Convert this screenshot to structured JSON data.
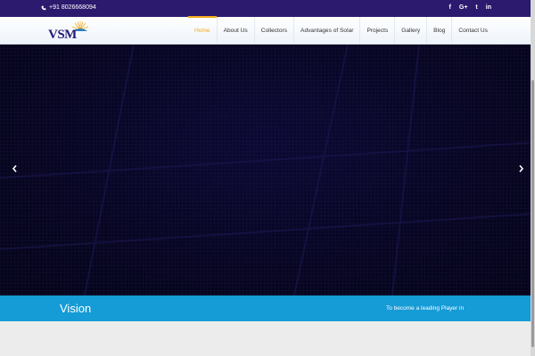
{
  "topbar": {
    "phone": "+91 8026668094",
    "social": [
      {
        "icon": "facebook-icon",
        "glyph": "f"
      },
      {
        "icon": "google-plus-icon",
        "glyph": "G+"
      },
      {
        "icon": "twitter-icon",
        "glyph": "t"
      },
      {
        "icon": "linkedin-icon",
        "glyph": "in"
      }
    ]
  },
  "header": {
    "logo_text": "VSM",
    "nav": [
      "Home",
      "About Us",
      "Collectors",
      "Advantages of Solar",
      "Projects",
      "Gallery",
      "Blog",
      "Contact Us"
    ],
    "active": "Home"
  },
  "band": {
    "title": "Vision",
    "tagline": "To become a leading Player in"
  },
  "colors": {
    "topbar": "#2b1a6e",
    "accent": "#f2a91b",
    "band": "#159bd6",
    "hero": "#070521"
  }
}
